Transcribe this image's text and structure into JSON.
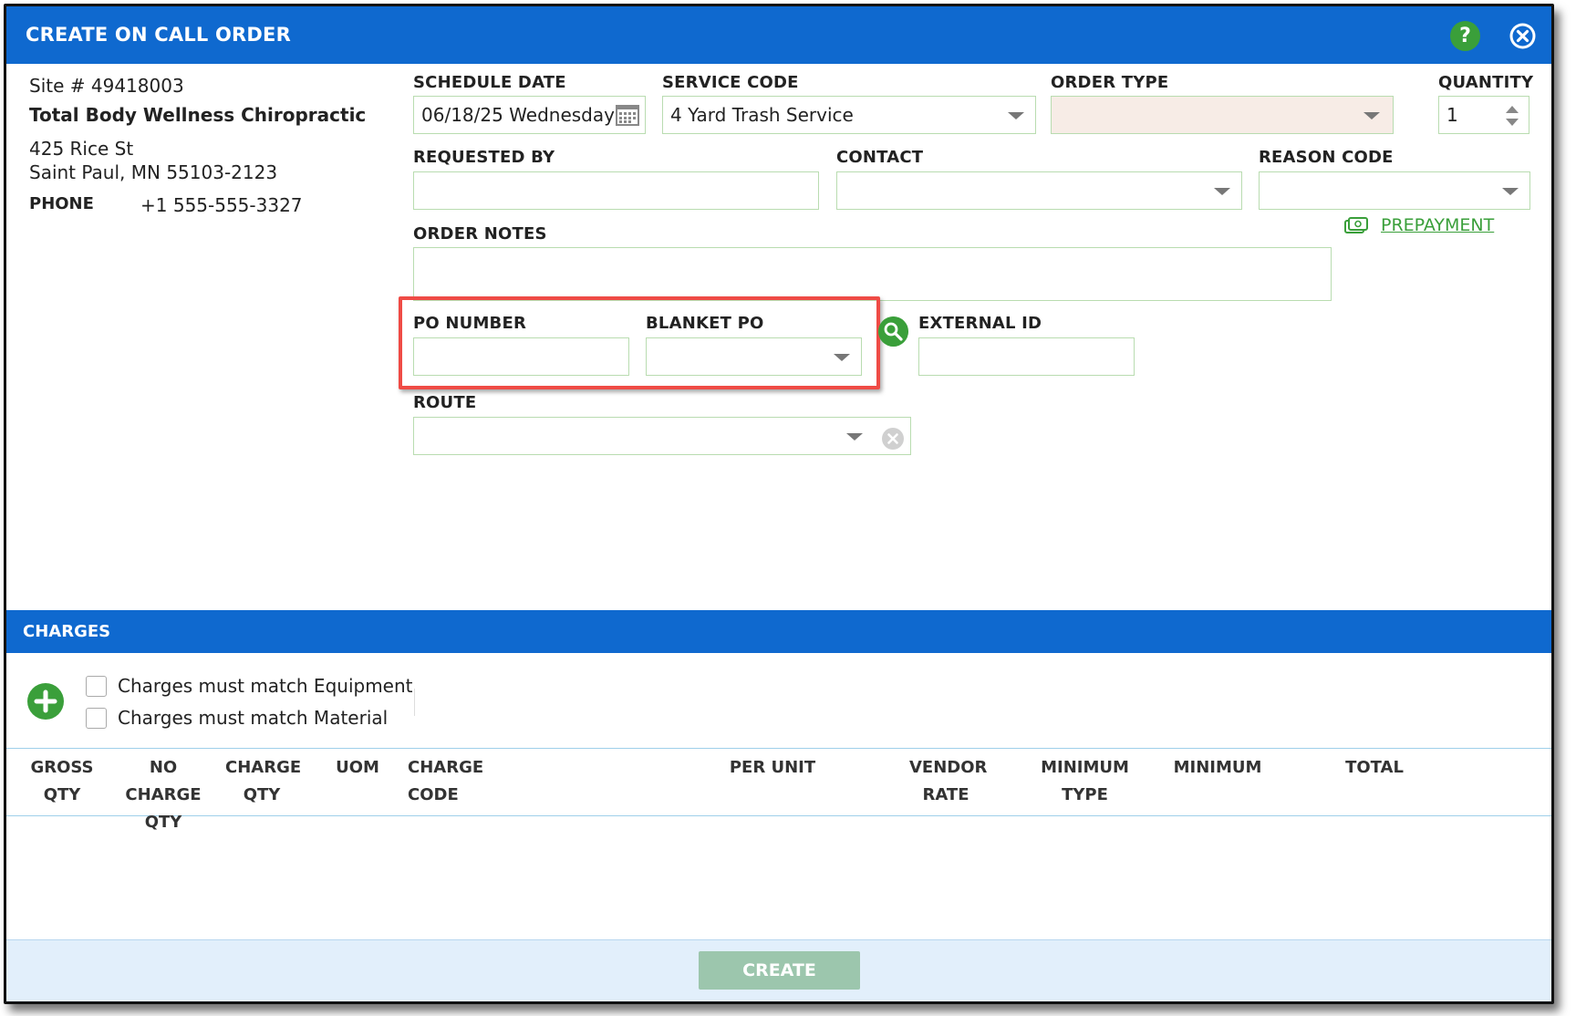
{
  "dialog": {
    "title": "CREATE ON CALL ORDER",
    "help_glyph": "?",
    "close_icon": "close-circle-icon"
  },
  "site": {
    "site_number": "Site # 49418003",
    "name": "Total Body Wellness Chiropractic",
    "address_line1": "425 Rice St",
    "address_line2": "Saint Paul, MN 55103-2123",
    "phone_label": "PHONE",
    "phone_value": "+1 555-555-3327"
  },
  "form": {
    "schedule_date_label": "SCHEDULE DATE",
    "schedule_date_value": "06/18/25 Wednesday",
    "service_code_label": "SERVICE CODE",
    "service_code_value": "4 Yard Trash Service",
    "order_type_label": "ORDER TYPE",
    "order_type_value": "",
    "quantity_label": "QUANTITY",
    "quantity_value": "1",
    "requested_by_label": "REQUESTED BY",
    "requested_by_value": "",
    "contact_label": "CONTACT",
    "contact_value": "",
    "reason_code_label": "REASON CODE",
    "reason_code_value": "",
    "prepayment_link": "PREPAYMENT",
    "order_notes_label": "ORDER NOTES",
    "order_notes_value": "",
    "po_number_label": "PO NUMBER",
    "po_number_value": "",
    "blanket_po_label": "BLANKET PO",
    "blanket_po_value": "",
    "external_id_label": "EXTERNAL ID",
    "external_id_value": "",
    "route_label": "ROUTE",
    "route_value": ""
  },
  "charges": {
    "title": "CHARGES",
    "match_equipment": "Charges must match Equipment",
    "match_material": "Charges must match Material",
    "columns": [
      "GROSS QTY",
      "NO CHARGE QTY",
      "CHARGE QTY",
      "UOM",
      "CHARGE CODE",
      "PER UNIT",
      "VENDOR RATE",
      "MINIMUM TYPE",
      "MINIMUM",
      "TOTAL"
    ]
  },
  "footer": {
    "create_label": "CREATE"
  },
  "colors": {
    "header_blue": "#0f69cf",
    "accent_green": "#3a9f3a",
    "highlight_red": "#ef4b45",
    "create_disabled": "#9cc6ad"
  }
}
